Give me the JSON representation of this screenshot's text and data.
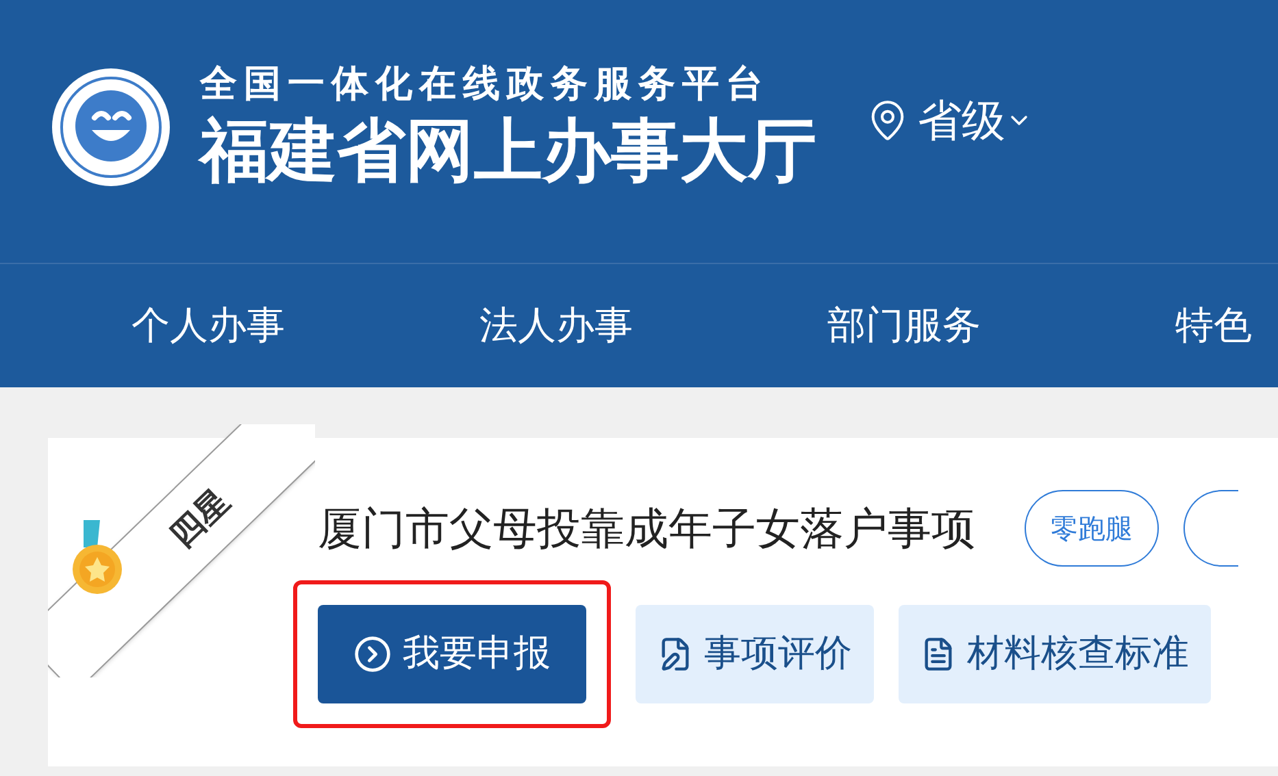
{
  "header": {
    "subtitle": "全国一体化在线政务服务平台",
    "title": "福建省网上办事大厅",
    "region": "省级"
  },
  "nav": [
    {
      "label": "个人办事"
    },
    {
      "label": "法人办事"
    },
    {
      "label": "部门服务"
    },
    {
      "label": "特色"
    }
  ],
  "item": {
    "rating": "四星",
    "title": "厦门市父母投靠成年子女落户事项",
    "tags": [
      "零跑腿"
    ],
    "actions": [
      {
        "label": "我要申报",
        "kind": "primary",
        "highlighted": true
      },
      {
        "label": "事项评价",
        "kind": "evaluate",
        "highlighted": false
      },
      {
        "label": "材料核查标准",
        "kind": "document",
        "highlighted": false
      }
    ]
  }
}
